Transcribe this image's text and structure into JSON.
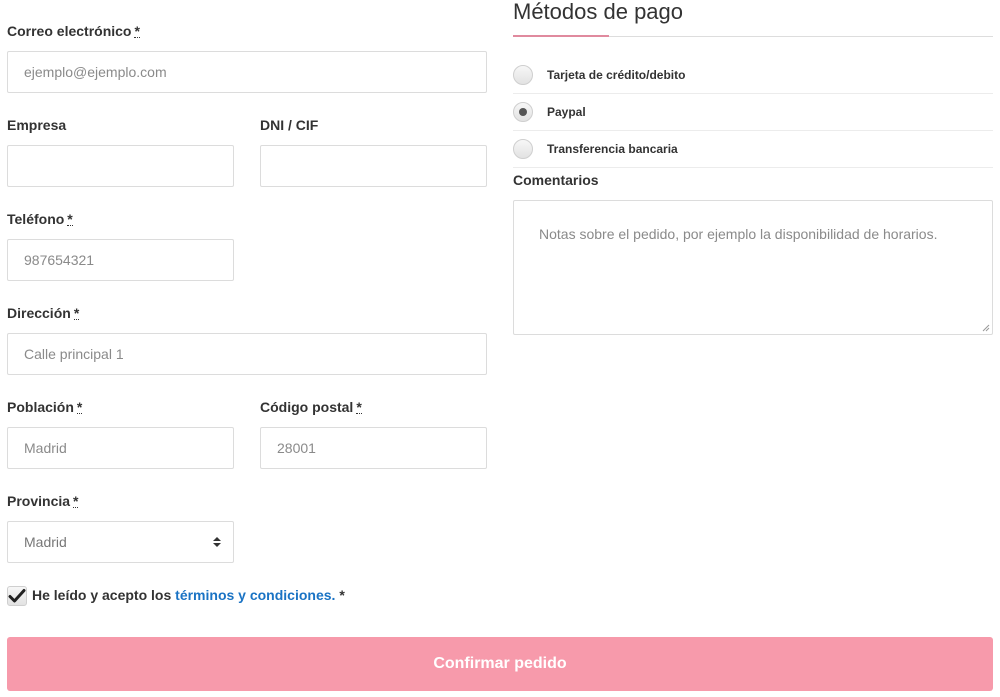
{
  "billing": {
    "email": {
      "label": "Correo electrónico",
      "required": "*",
      "placeholder": "ejemplo@ejemplo.com"
    },
    "company": {
      "label": "Empresa"
    },
    "tax_id": {
      "label": "DNI / CIF"
    },
    "phone": {
      "label": "Teléfono",
      "required": "*",
      "placeholder": "987654321"
    },
    "address": {
      "label": "Dirección",
      "required": "*",
      "placeholder": "Calle principal 1"
    },
    "city": {
      "label": "Población",
      "required": "*",
      "placeholder": "Madrid"
    },
    "postcode": {
      "label": "Código postal",
      "required": "*",
      "placeholder": "28001"
    },
    "province": {
      "label": "Provincia",
      "required": "*",
      "value": "Madrid"
    }
  },
  "terms": {
    "prefix": "He leído y acepto los",
    "link": "términos y condiciones.",
    "required": "*",
    "checked": true
  },
  "confirm_button": {
    "label": "Confirmar pedido"
  },
  "payment": {
    "title": "Métodos de pago",
    "methods": [
      {
        "label": "Tarjeta de crédito/debito",
        "selected": false
      },
      {
        "label": "Paypal",
        "selected": true
      },
      {
        "label": "Transferencia bancaria",
        "selected": false
      }
    ]
  },
  "comments": {
    "label": "Comentarios",
    "placeholder": "Notas sobre el pedido, por ejemplo la disponibilidad de horarios."
  },
  "colors": {
    "accent_pink": "#f79aab",
    "link_blue": "#1a73c4"
  }
}
